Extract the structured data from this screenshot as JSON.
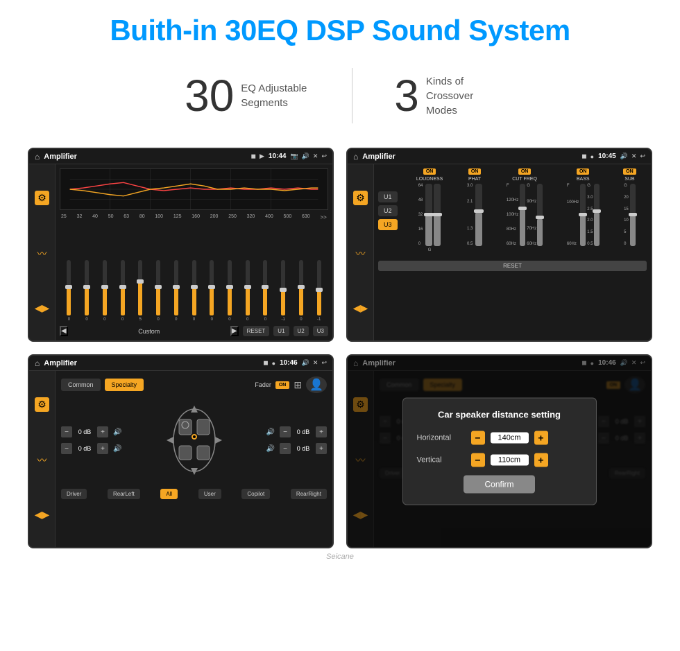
{
  "header": {
    "title": "Buith-in 30EQ DSP Sound System"
  },
  "stats": [
    {
      "number": "30",
      "description": "EQ Adjustable Segments"
    },
    {
      "number": "3",
      "description": "Kinds of Crossover Modes"
    }
  ],
  "screens": [
    {
      "id": "eq-screen",
      "topbar": {
        "title": "Amplifier",
        "time": "10:44"
      },
      "eq": {
        "bands": [
          "25",
          "32",
          "40",
          "50",
          "63",
          "80",
          "100",
          "125",
          "160",
          "200",
          "250",
          "320",
          "400",
          "500",
          "630"
        ],
        "values": [
          "0",
          "0",
          "0",
          "0",
          "5",
          "0",
          "0",
          "0",
          "0",
          "0",
          "0",
          "0",
          "-1",
          "0",
          "-1"
        ],
        "sliderHeights": [
          50,
          50,
          50,
          50,
          60,
          50,
          50,
          50,
          50,
          50,
          50,
          50,
          45,
          50,
          45
        ],
        "preset": "Custom",
        "buttons": [
          "RESET",
          "U1",
          "U2",
          "U3"
        ]
      }
    },
    {
      "id": "crossover-screen",
      "topbar": {
        "title": "Amplifier",
        "time": "10:45"
      },
      "crossover": {
        "activePreset": "U3",
        "channels": [
          {
            "name": "LOUDNESS",
            "on": true
          },
          {
            "name": "PHAT",
            "on": true
          },
          {
            "name": "CUT FREQ",
            "on": true
          },
          {
            "name": "BASS",
            "on": true
          },
          {
            "name": "SUB",
            "on": true
          }
        ]
      }
    },
    {
      "id": "specialty-screen",
      "topbar": {
        "title": "Amplifier",
        "time": "10:46"
      },
      "specialty": {
        "modes": [
          "Common",
          "Specialty"
        ],
        "activeMode": "Specialty",
        "faderOn": true,
        "values": {
          "frontLeft": "0 dB",
          "frontRight": "0 dB",
          "rearLeft": "0 dB",
          "rearRight": "0 dB"
        },
        "buttons": [
          "Driver",
          "RearLeft",
          "All",
          "User",
          "Copilot",
          "RearRight"
        ],
        "activeButton": "All"
      }
    },
    {
      "id": "distance-screen",
      "topbar": {
        "title": "Amplifier",
        "time": "10:46"
      },
      "dialog": {
        "title": "Car speaker distance setting",
        "horizontal": {
          "label": "Horizontal",
          "value": "140cm"
        },
        "vertical": {
          "label": "Vertical",
          "value": "110cm"
        },
        "confirmButton": "Confirm"
      }
    }
  ],
  "watermark": "Seicane",
  "colors": {
    "accent": "#f5a623",
    "brand": "#0099ff",
    "bg": "#1a1a1a",
    "text": "#ffffff"
  }
}
